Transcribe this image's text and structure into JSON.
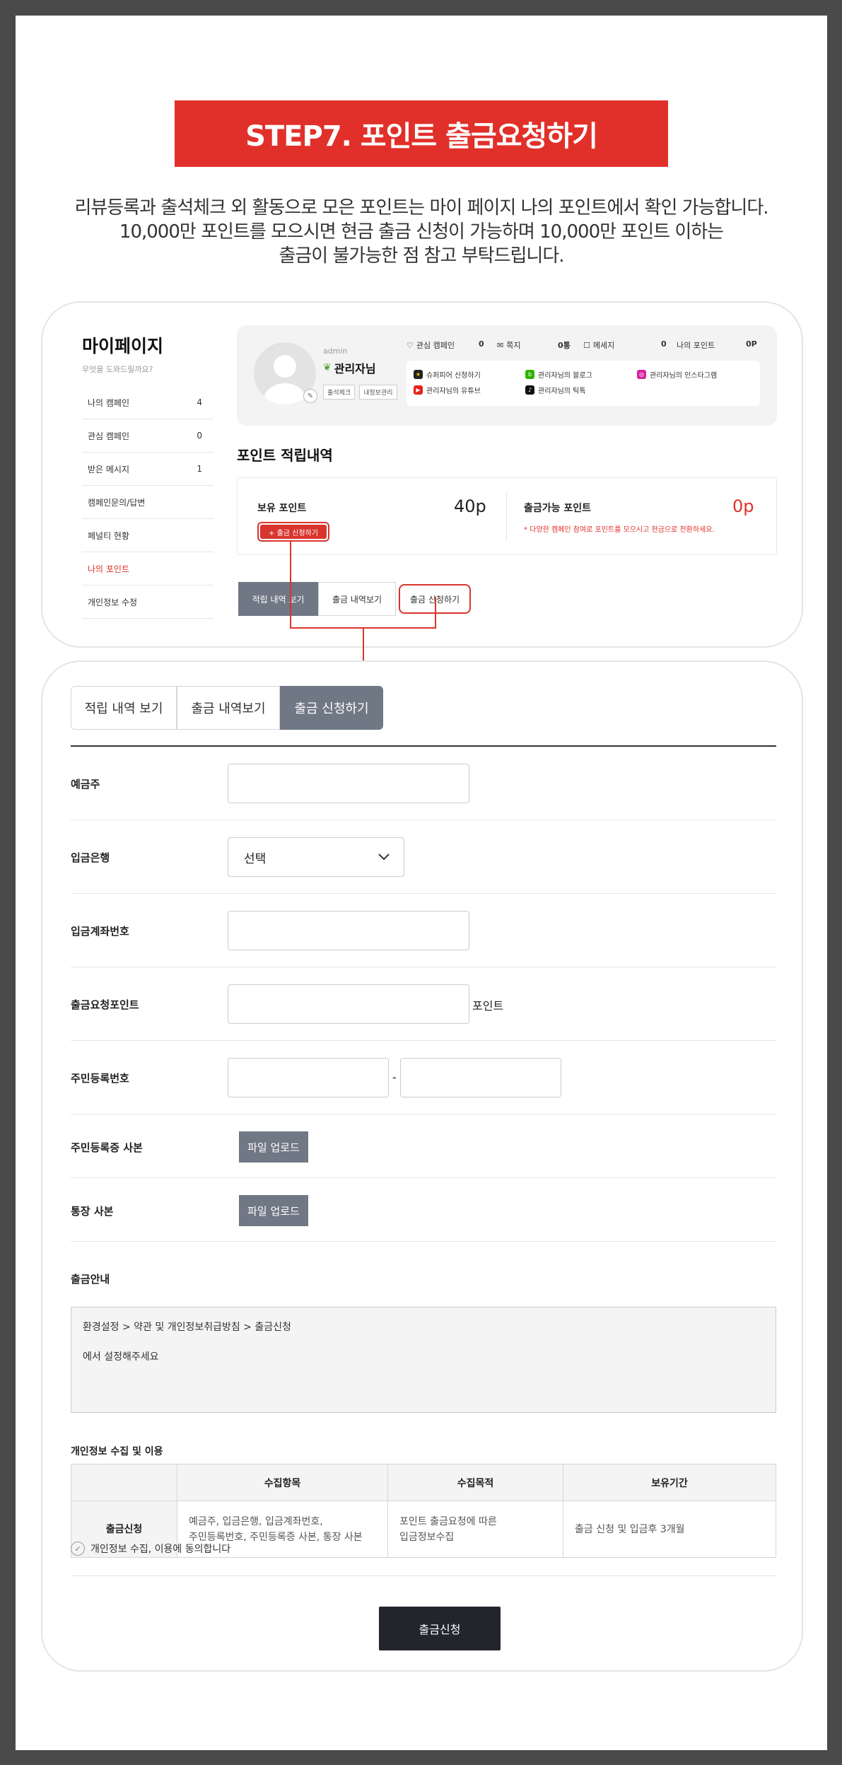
{
  "banner": {
    "title": "STEP7. 포인트 출금요청하기"
  },
  "description": {
    "line1": "리뷰등록과 출석체크 외 활동으로 모은 포인트는 마이 페이지 나의 포인트에서 확인 가능합니다.",
    "line2": "10,000만 포인트를 모으시면 현금 출금 신청이 가능하며 10,000만 포인트 이하는",
    "line3": "출금이 불가능한 점 참고 부탁드립니다."
  },
  "mypage": {
    "title": "마이페이지",
    "subtitle": "무엇을 도와드릴까요?",
    "side_items": [
      {
        "label": "나의 캠페인",
        "count": "4"
      },
      {
        "label": "관심 캠페인",
        "count": "0"
      },
      {
        "label": "받은 메시지",
        "count": "1"
      },
      {
        "label": "캠페인문의/답변",
        "count": ""
      },
      {
        "label": "페널티 현황",
        "count": ""
      },
      {
        "label": "나의 포인트",
        "count": ""
      },
      {
        "label": "개인정보 수정",
        "count": ""
      }
    ]
  },
  "profile": {
    "user_id": "admin",
    "name": "관리자님",
    "btn_attendance": "출석체크",
    "btn_info": "내정보관리",
    "stats": [
      {
        "label": "관심 캠페인",
        "value": "0"
      },
      {
        "label": "쪽지",
        "value": "0통"
      },
      {
        "label": "메세지",
        "value": "0"
      },
      {
        "label": "나의 포인트",
        "value": "0P"
      }
    ],
    "links": {
      "superpeer": "슈퍼피어 신청하기",
      "blog": "관리자님의 블로그",
      "instagram": "관리자님의 인스타그램",
      "youtube": "관리자님의 유튜브",
      "tiktok": "관리자님의 틱톡"
    }
  },
  "points": {
    "title": "포인트 적립내역",
    "hold_label": "보유 포인트",
    "hold_value": "40p",
    "withdraw_btn": "+ 출금 신청하기",
    "avail_label": "출금가능 포인트",
    "avail_value": "0p",
    "avail_note": "* 다양한 캠페인 참여로 포인트를 모으시고 현금으로 전환하세요."
  },
  "tabs_small": [
    "적립 내역 보기",
    "출금 내역보기",
    "출금 신청하기"
  ],
  "tabs_large": [
    "적립 내역 보기",
    "출금 내역보기",
    "출금 신청하기"
  ],
  "form": {
    "depositor": "예금주",
    "bank": "입금은행",
    "bank_selected": "선택",
    "account": "입금계좌번호",
    "request_points": "출금요청포인트",
    "points_unit": "포인트",
    "resident_no": "주민등록번호",
    "dash": "-",
    "id_copy": "주민등록증 사본",
    "bankbook_copy": "통장 사본",
    "upload_label": "파일 업로드"
  },
  "guide": {
    "title": "출금안내",
    "line1": "환경설정 > 약관 및 개인정보취급방침 > 출금신청",
    "line2": "에서 설정해주세요"
  },
  "privacy": {
    "title": "개인정보 수집 및 이용",
    "headers": [
      "",
      "수집항목",
      "수집목적",
      "보유기간"
    ],
    "row_head": "출금신청",
    "items_line1": "예금주, 입금은행, 입금계좌번호,",
    "items_line2": "주민등록번호, 주민등록증 사본, 통장 사본",
    "purpose_line1": "포인트 출금요청에 따른",
    "purpose_line2": "입금정보수집",
    "period": "출금 신청 및 입금후 3개월",
    "agree": "개인정보 수집, 이용에 동의합니다"
  },
  "submit_label": "출금신청",
  "colors": {
    "accent": "#e1302a",
    "tab_active": "#707785",
    "submit": "#22262c"
  }
}
